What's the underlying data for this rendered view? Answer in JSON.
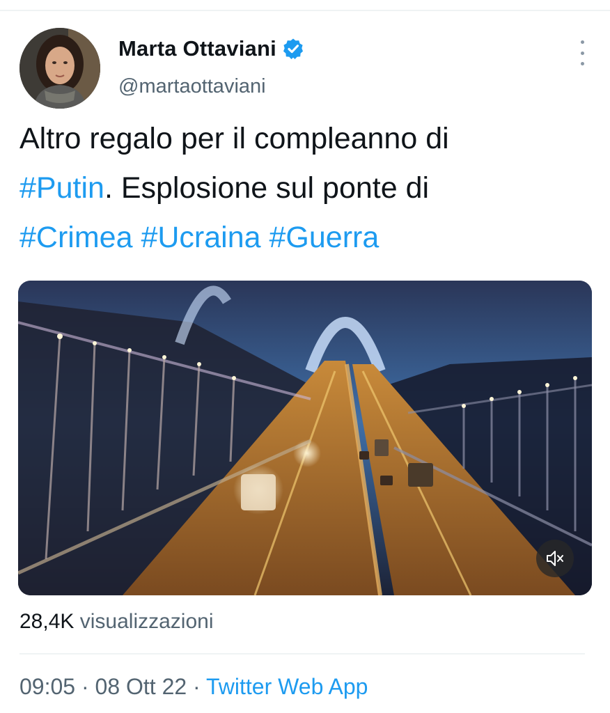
{
  "author": {
    "display_name": "Marta Ottaviani",
    "handle": "@martaottaviani",
    "verified": true,
    "verified_color": "#1d9bf0"
  },
  "tweet": {
    "text_plain_1": "Altro regalo per il compleanno di",
    "hashtag_putin": "#Putin",
    "text_plain_2": ". Esplosione sul ponte di",
    "hashtag_crimea": "#Crimea",
    "hashtag_ucraina": "#Ucraina",
    "hashtag_guerra": "#Guerra",
    "hashtag_color": "#1d9bf0"
  },
  "media": {
    "type": "video",
    "mute_icon": "speaker-muted-icon"
  },
  "stats": {
    "views_count": "28,4K",
    "views_label": "visualizzazioni"
  },
  "meta": {
    "time": "09:05",
    "separator": "·",
    "date": "08 Ott 22",
    "source": "Twitter Web App"
  },
  "icons": {
    "more": "more-vertical-icon",
    "verified": "verified-badge-icon"
  }
}
